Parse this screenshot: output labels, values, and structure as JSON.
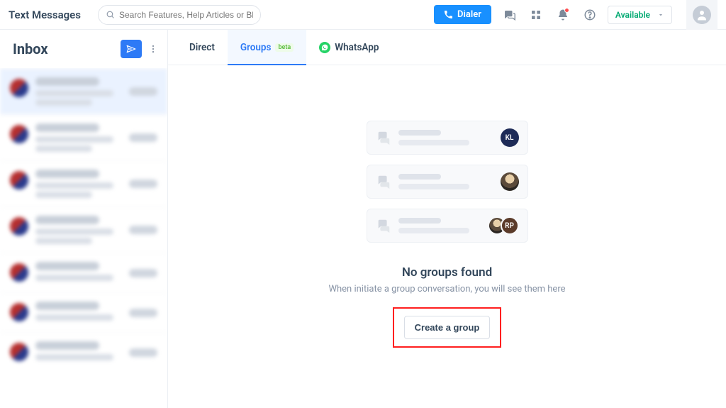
{
  "header": {
    "title": "Text Messages",
    "search_placeholder": "Search Features, Help Articles or Blogs",
    "dialer_label": "Dialer",
    "availability_label": "Available"
  },
  "sidebar": {
    "title": "Inbox"
  },
  "tabs": {
    "direct": "Direct",
    "groups": "Groups",
    "groups_badge": "beta",
    "whatsapp": "WhatsApp"
  },
  "empty_state": {
    "cards": [
      {
        "avatar_label": "KL"
      },
      {
        "avatar_label": ""
      },
      {
        "avatar_label": "RP"
      }
    ],
    "title": "No groups found",
    "subtitle": "When initiate a group conversation, you will see them here",
    "cta_label": "Create a group"
  }
}
